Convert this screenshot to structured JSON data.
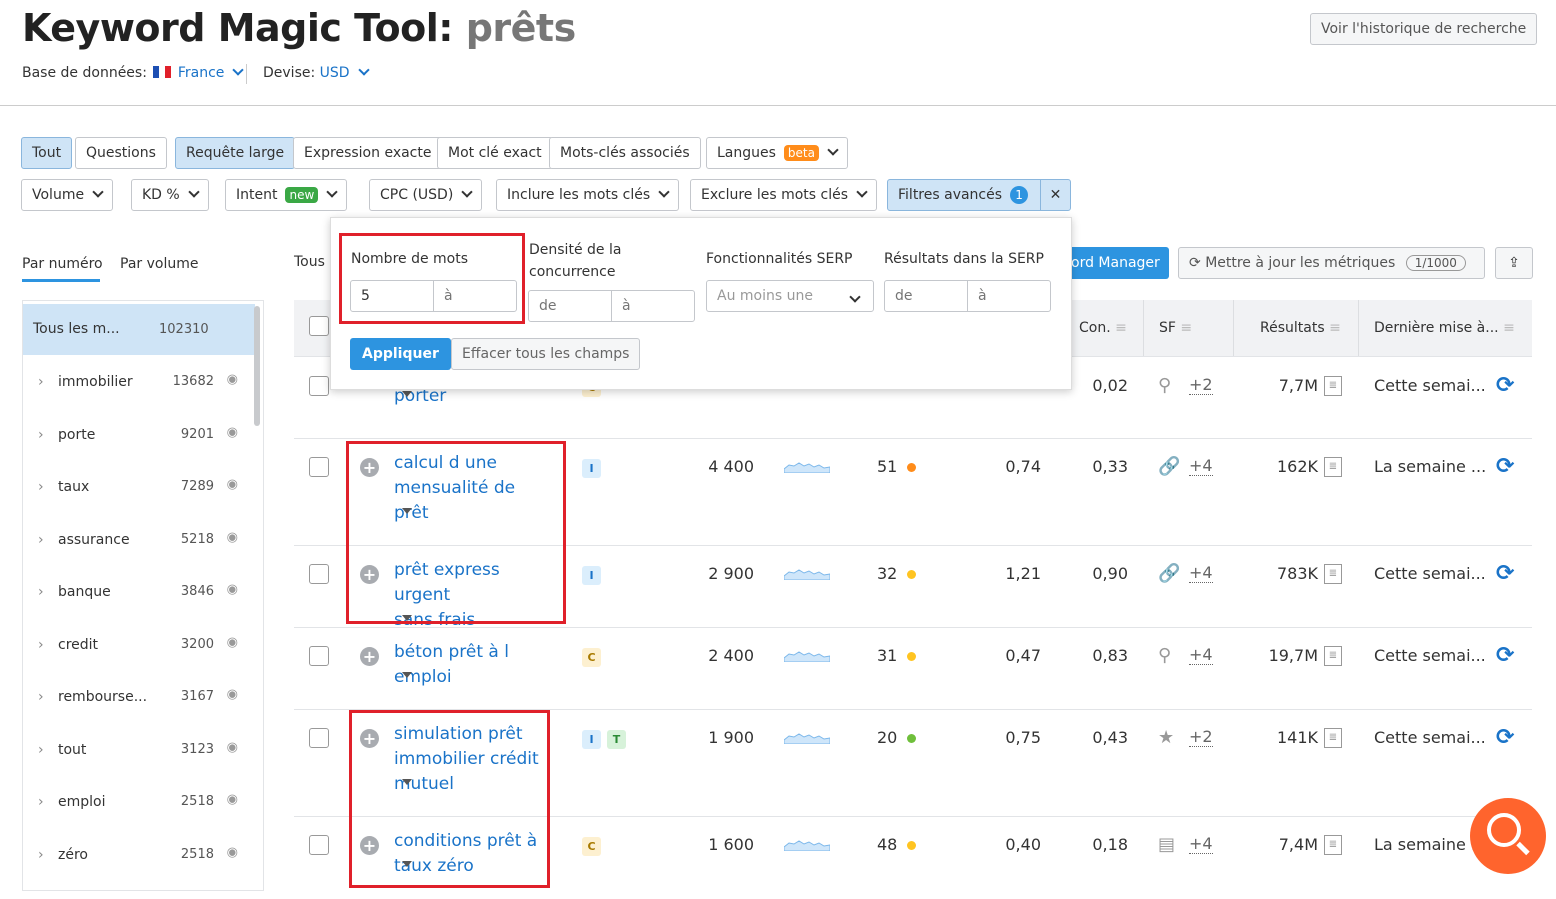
{
  "header": {
    "title": "Keyword Magic Tool:",
    "query": "prêts",
    "db_label": "Base de données:",
    "db_value": "France",
    "currency_label": "Devise:",
    "currency_value": "USD",
    "history_button": "Voir l'historique de recherche"
  },
  "filters_row1": {
    "tout": "Tout",
    "questions": "Questions",
    "large": "Requête large",
    "exact_expr": "Expression exacte",
    "exact_kw": "Mot clé exact",
    "related": "Mots-clés associés",
    "langues": "Langues",
    "beta": "beta"
  },
  "filters_row2": {
    "volume": "Volume",
    "kd": "KD %",
    "intent": "Intent",
    "new": "new",
    "cpc": "CPC (USD)",
    "include": "Inclure les mots clés",
    "exclude": "Exclure les mots clés",
    "advanced": "Filtres avancés",
    "advanced_count": "1"
  },
  "popup": {
    "words_label": "Nombre de mots",
    "words_from": "5",
    "words_to_ph": "à",
    "density_label": "Densité de la concurrence",
    "from_ph": "de",
    "to_ph": "à",
    "serp_label": "Fonctionnalités SERP",
    "serp_value": "Au moins une",
    "results_label": "Résultats dans la SERP",
    "apply": "Appliquer",
    "clear": "Effacer tous les champs"
  },
  "sidebar": {
    "tab1": "Par numéro",
    "tab2": "Par volume",
    "all_label": "Tous les m...",
    "all_count": "102310",
    "items": [
      {
        "label": "immobilier",
        "count": "13682"
      },
      {
        "label": "porte",
        "count": "9201"
      },
      {
        "label": "taux",
        "count": "7289"
      },
      {
        "label": "assurance",
        "count": "5218"
      },
      {
        "label": "banque",
        "count": "3846"
      },
      {
        "label": "credit",
        "count": "3200"
      },
      {
        "label": "rembourse...",
        "count": "3167"
      },
      {
        "label": "tout",
        "count": "3123"
      },
      {
        "label": "emploi",
        "count": "2518"
      },
      {
        "label": "zéro",
        "count": "2518"
      }
    ]
  },
  "toolbar": {
    "tous": "Tous",
    "manager": "ord Manager",
    "update": "Mettre à jour les métriques",
    "update_count": "1/1000"
  },
  "table": {
    "headers": {
      "con": "Con.",
      "sf": "SF",
      "results": "Résultats",
      "updated": "Dernière mise à..."
    },
    "rows": [
      {
        "kw1": "",
        "kw2": "",
        "kw3": "porter",
        "intents": [
          "C"
        ],
        "volume": "",
        "kd": "",
        "kd_color": "",
        "cpc": "",
        "con": "0,02",
        "sf_icon": "location-pin",
        "sf_more": "+2",
        "results": "7,7M",
        "updated": "Cette semai..."
      },
      {
        "kw1": "calcul d une",
        "kw2": "mensualité de",
        "kw3": "prêt",
        "intents": [
          "I"
        ],
        "volume": "4 400",
        "kd": "51",
        "kd_color": "#ff8c1a",
        "cpc": "0,74",
        "con": "0,33",
        "sf_icon": "link",
        "sf_more": "+4",
        "results": "162K",
        "updated": "La semaine ..."
      },
      {
        "kw1": "prêt express urgent",
        "kw2": "sans frais",
        "kw3": "",
        "intents": [
          "I"
        ],
        "volume": "2 900",
        "kd": "32",
        "kd_color": "#ffc421",
        "cpc": "1,21",
        "con": "0,90",
        "sf_icon": "link",
        "sf_more": "+4",
        "results": "783K",
        "updated": "Cette semai..."
      },
      {
        "kw1": "béton prêt à l",
        "kw2": "emploi",
        "kw3": "",
        "intents": [
          "C"
        ],
        "volume": "2 400",
        "kd": "31",
        "kd_color": "#ffc421",
        "cpc": "0,47",
        "con": "0,83",
        "sf_icon": "location-pin",
        "sf_more": "+4",
        "results": "19,7M",
        "updated": "Cette semai..."
      },
      {
        "kw1": "simulation prêt",
        "kw2": "immobilier crédit",
        "kw3": "mutuel",
        "intents": [
          "I",
          "T"
        ],
        "volume": "1 900",
        "kd": "20",
        "kd_color": "#6fbf3b",
        "cpc": "0,75",
        "con": "0,43",
        "sf_icon": "star",
        "sf_more": "+2",
        "results": "141K",
        "updated": "Cette semai..."
      },
      {
        "kw1": "conditions prêt à",
        "kw2": "taux zéro",
        "kw3": "",
        "intents": [
          "C"
        ],
        "volume": "1 600",
        "kd": "48",
        "kd_color": "#ffc421",
        "cpc": "0,40",
        "con": "0,18",
        "sf_icon": "news",
        "sf_more": "+4",
        "results": "7,4M",
        "updated": "La semaine ..."
      }
    ]
  },
  "colors": {
    "accent": "#2d94e0",
    "link": "#1a73c8",
    "highlight": "#e0202a",
    "search_fab": "#ff642d"
  }
}
